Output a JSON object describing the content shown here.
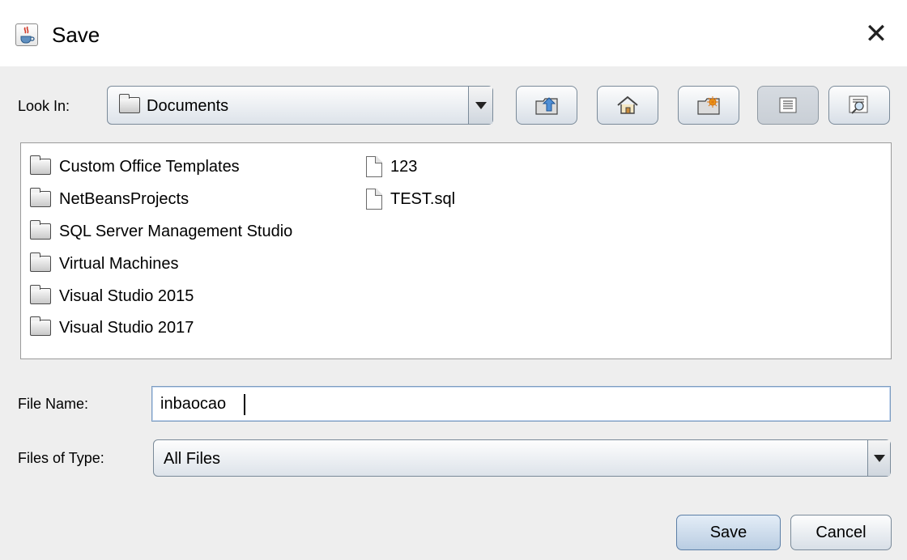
{
  "window": {
    "title": "Save",
    "close_glyph": "✕"
  },
  "look_in": {
    "label": "Look In:",
    "value": "Documents"
  },
  "toolbar": [
    {
      "name": "up-one-level-button",
      "icon": "folder-up-icon"
    },
    {
      "name": "home-button",
      "icon": "home-icon"
    },
    {
      "name": "new-folder-button",
      "icon": "new-folder-icon"
    },
    {
      "name": "list-view-button",
      "icon": "list-view-icon",
      "pressed": true
    },
    {
      "name": "details-view-button",
      "icon": "details-view-icon"
    }
  ],
  "files": [
    {
      "name": "Custom Office Templates",
      "type": "folder"
    },
    {
      "name": "NetBeansProjects",
      "type": "folder"
    },
    {
      "name": "SQL Server Management Studio",
      "type": "folder"
    },
    {
      "name": "Virtual Machines",
      "type": "folder"
    },
    {
      "name": "Visual Studio 2015",
      "type": "folder"
    },
    {
      "name": "Visual Studio 2017",
      "type": "folder"
    },
    {
      "name": "123",
      "type": "file"
    },
    {
      "name": "TEST.sql",
      "type": "file"
    }
  ],
  "file_name": {
    "label": "File Name:",
    "value": "inbaocao"
  },
  "file_type": {
    "label": "Files of Type:",
    "value": "All Files"
  },
  "buttons": {
    "save": "Save",
    "cancel": "Cancel"
  }
}
